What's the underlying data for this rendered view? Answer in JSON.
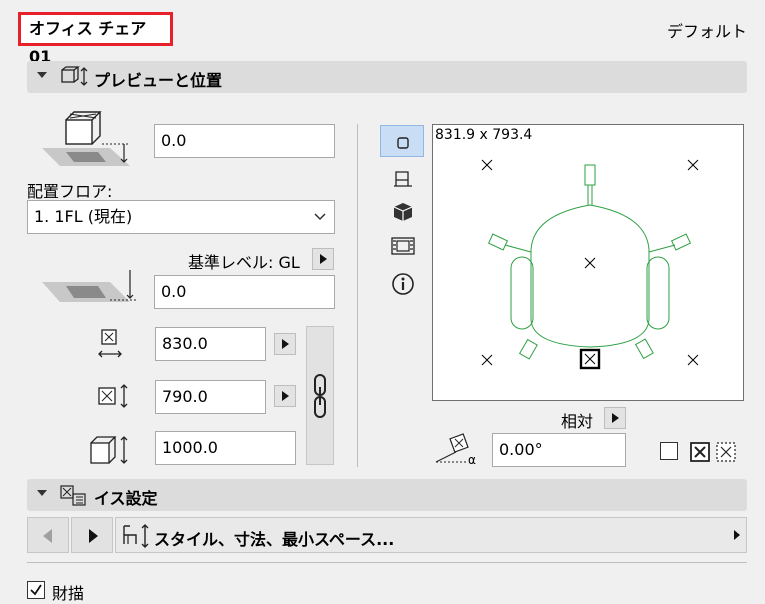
{
  "header": {
    "title": "オフィス チェア 01",
    "default_label": "デフォルト"
  },
  "preview_section": {
    "title": "プレビューと位置",
    "offset_value": "0.0",
    "floor_label": "配置フロア:",
    "floor_selected": "1. 1FL (現在)",
    "ref_level_label": "基準レベル: GL",
    "elevation_value": "0.0",
    "width_value": "830.0",
    "depth_value": "790.0",
    "height_value": "1000.0",
    "preview_size": "831.9 x 793.4",
    "relative_label": "相対",
    "angle_value": "0.00°"
  },
  "chair_section": {
    "title": "イス設定",
    "style_label": "スタイル、寸法、最小スペース..."
  },
  "footer": {
    "partial_label": "財描"
  }
}
